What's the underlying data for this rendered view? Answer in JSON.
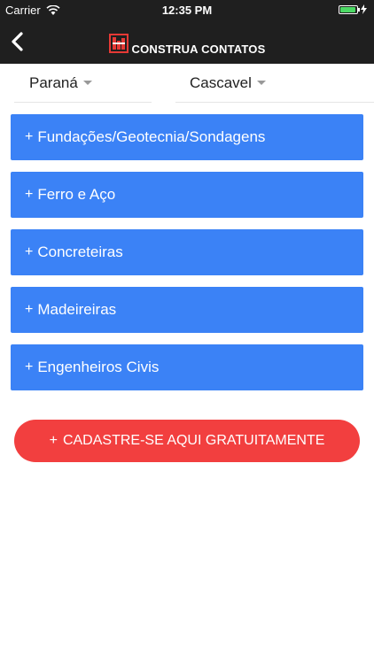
{
  "status_bar": {
    "carrier": "Carrier",
    "time": "12:35 PM"
  },
  "nav": {
    "brand": "CONSTRUA CONTATOS"
  },
  "filters": {
    "state": "Paraná",
    "city": "Cascavel"
  },
  "categories": [
    {
      "label": "Fundações/Geotecnia/Sondagens"
    },
    {
      "label": "Ferro e Aço"
    },
    {
      "label": "Concreteiras"
    },
    {
      "label": "Madeireiras"
    },
    {
      "label": "Engenheiros Civis"
    }
  ],
  "cta": {
    "label": "CADASTRE-SE AQUI GRATUITAMENTE"
  },
  "colors": {
    "header_bg": "#1f1f1f",
    "category_blue": "#3b82f6",
    "cta_red": "#f23f3f",
    "battery_green": "#4cd964"
  }
}
